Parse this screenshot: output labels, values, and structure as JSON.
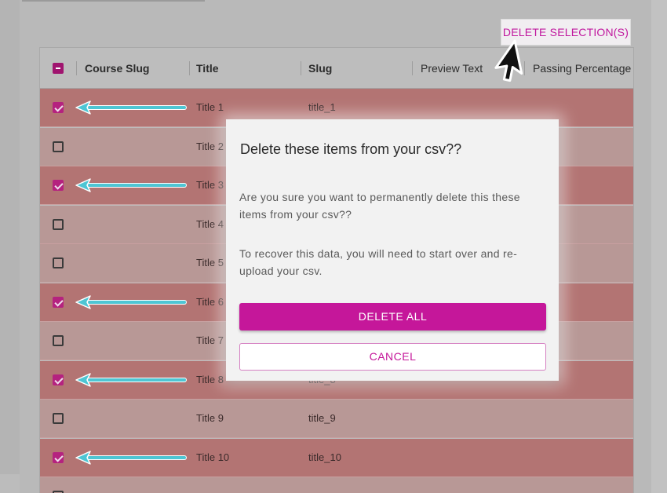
{
  "toolbar": {
    "delete_selection_label": "DELETE SELECTION(S)"
  },
  "table": {
    "columns": [
      "Course Slug",
      "Title",
      "Slug",
      "Preview Text",
      "Passing Percentage"
    ],
    "rows": [
      {
        "title": "Title 1",
        "slug": "title_1",
        "selected": true
      },
      {
        "title": "Title 2",
        "slug": "",
        "selected": false
      },
      {
        "title": "Title 3",
        "slug": "",
        "selected": true
      },
      {
        "title": "Title 4",
        "slug": "",
        "selected": false
      },
      {
        "title": "Title 5",
        "slug": "",
        "selected": false
      },
      {
        "title": "Title 6",
        "slug": "",
        "selected": true
      },
      {
        "title": "Title 7",
        "slug": "",
        "selected": false
      },
      {
        "title": "Title 8",
        "slug": "title_8",
        "selected": true
      },
      {
        "title": "Title 9",
        "slug": "title_9",
        "selected": false
      },
      {
        "title": "Title 10",
        "slug": "title_10",
        "selected": true
      }
    ]
  },
  "modal": {
    "title": "Delete these items from your csv??",
    "body_1": "Are you sure you want to permanently delete this these items from your csv??",
    "body_2": "To recover this data, you will need to start over and re-upload your csv.",
    "delete_all_label": "DELETE ALL",
    "cancel_label": "CANCEL"
  },
  "colors": {
    "accent": "#c5179a",
    "selected_row": "#b37473",
    "unselected_row": "#b89896",
    "annotation_arrow": "#4ec6d4"
  },
  "icons": {
    "header_checkbox": "indeterminate-checkbox-icon",
    "row_checkbox": "checkbox-icon",
    "annotation": "arrow-left-icon",
    "pointer": "mouse-cursor-icon"
  }
}
